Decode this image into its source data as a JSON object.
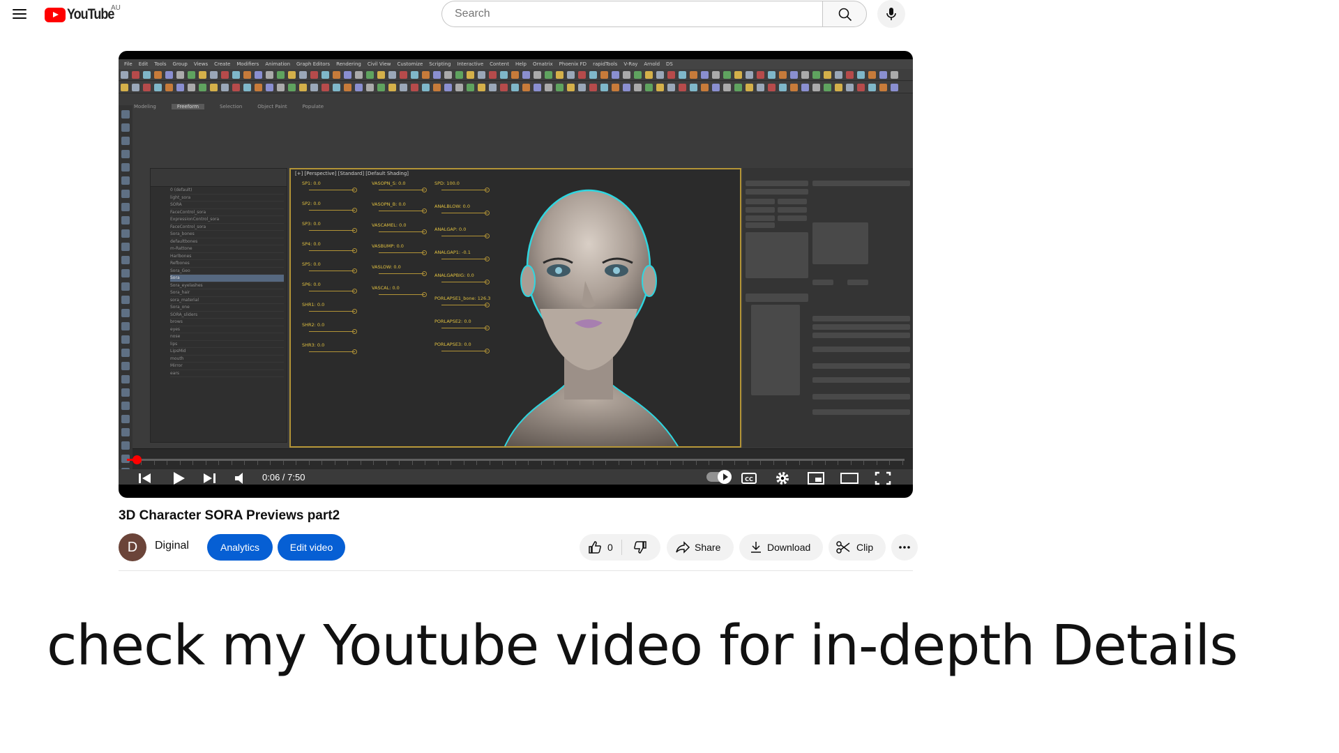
{
  "header": {
    "logo_text": "YouTube",
    "region": "AU",
    "search_placeholder": "Search"
  },
  "player": {
    "time_display": "0:06 / 7:50",
    "progress_fraction": 0.0128,
    "app_menu": [
      "File",
      "Edit",
      "Tools",
      "Group",
      "Views",
      "Create",
      "Modifiers",
      "Animation",
      "Graph Editors",
      "Rendering",
      "Civil View",
      "Customize",
      "Scripting",
      "Interactive",
      "Content",
      "Help",
      "Ornatrix",
      "Phoenix FD",
      "rapidTools",
      "V-Ray",
      "Arnold",
      "DS"
    ],
    "ribbon_tabs": [
      "Modeling",
      "Freeform",
      "Selection",
      "Object Paint",
      "Populate"
    ],
    "viewport_label": "[+] [Perspective] [Standard] [Default Shading]",
    "scene_rows": [
      "0 (default)",
      "light_sora",
      "SORA",
      "FaceControl_sora",
      "ExpressionControl_sora",
      "FaceControl_sora",
      "Sora_bones",
      "defaultbones",
      "m-Rattone",
      "Harlbones",
      "Refbones",
      "Sora_Geo",
      "Sora",
      "Sora_eyelashes",
      "Sora_hair",
      "sora_material",
      "Sora_one",
      "SORA_sliders",
      "brows",
      "eyes",
      "nose",
      "lips",
      "LipsMid",
      "mouth",
      "Mirror",
      "ears"
    ],
    "sliders": [
      "SP1: 0.0",
      "SP2: 0.0",
      "SP3: 0.0",
      "SP4: 0.0",
      "SP5: 0.0",
      "SP6: 0.0",
      "SHR1: 0.0",
      "SHR2: 0.0",
      "SHR3: 0.0",
      "VASOPN_S: 0.0",
      "VASOPN_B: 0.0",
      "VASCAMEL: 0.0",
      "VASBUMP: 0.0",
      "VASLOW: 0.0",
      "VASCAL: 0.0",
      "SPD: 100.0",
      "ANALBLOW: 0.0",
      "ANALGAP: 0.0",
      "ANALGAP1: -0.1",
      "ANALGAPBIG: 0.0",
      "PORLAPSE1_bone: 126.3",
      "PORLAPSE2: 0.0",
      "PORLAPSE3: 0.0"
    ]
  },
  "video": {
    "title": "3D Character SORA Previews part2",
    "channel_initial": "D",
    "channel_name": "Diginal",
    "analytics_label": "Analytics",
    "edit_label": "Edit video",
    "like_count": "0",
    "share_label": "Share",
    "download_label": "Download",
    "clip_label": "Clip"
  },
  "caption": "check my Youtube video for in-depth Details",
  "colors": {
    "youtube_red": "#ff0000",
    "action_blue": "#065fd4",
    "pill_gray": "#f2f2f2",
    "viewport_border": "#b39436",
    "slider_text": "#e0c040",
    "avatar_brown": "#6b4439"
  }
}
